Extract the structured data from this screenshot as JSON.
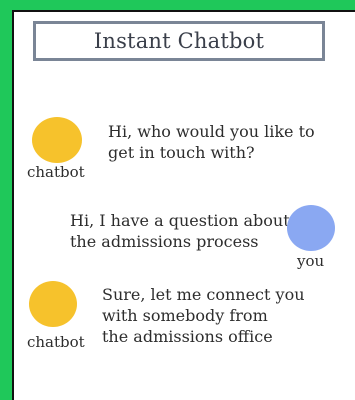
{
  "app": {
    "title": "Instant Chatbot"
  },
  "messages": [
    {
      "sender": "chatbot",
      "sender_label": "chatbot",
      "lines": [
        "Hi, who would you like to",
        "get in touch with?"
      ],
      "avatar_color": "#f6c22c"
    },
    {
      "sender": "user",
      "sender_label": "you",
      "lines": [
        "Hi, I have a question about",
        "the admissions process"
      ],
      "avatar_color": "#8aa8f2"
    },
    {
      "sender": "chatbot",
      "sender_label": "chatbot",
      "lines": [
        "Sure, let me connect you",
        "with somebody from",
        "the admissions office"
      ],
      "avatar_color": "#f6c22c"
    }
  ],
  "colors": {
    "background": "#1fc85a",
    "panel": "#ffffff",
    "title_border": "#7a8596"
  }
}
